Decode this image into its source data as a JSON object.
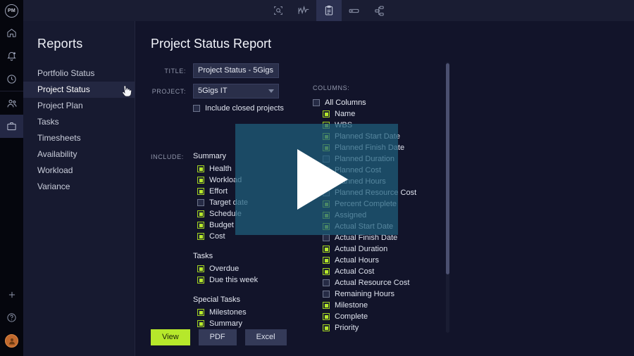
{
  "rail": {
    "logo": "PM",
    "items": [
      {
        "name": "home-icon",
        "label": "Home"
      },
      {
        "name": "notifications-icon",
        "label": "Notifications"
      },
      {
        "name": "time-icon",
        "label": "Time"
      },
      {
        "name": "people-icon",
        "label": "People"
      },
      {
        "name": "briefcase-icon",
        "label": "Projects",
        "active": true
      }
    ],
    "bottom": [
      {
        "name": "add-icon",
        "label": "Add"
      },
      {
        "name": "help-icon",
        "label": "Help"
      },
      {
        "name": "avatar",
        "label": "User"
      }
    ]
  },
  "toolbar": {
    "items": [
      {
        "name": "search-document-icon",
        "label": "Search",
        "active": false
      },
      {
        "name": "analytics-icon",
        "label": "Analytics",
        "active": false
      },
      {
        "name": "clipboard-icon",
        "label": "Reports",
        "active": true
      },
      {
        "name": "card-icon",
        "label": "Board",
        "active": false
      },
      {
        "name": "hierarchy-icon",
        "label": "Structure",
        "active": false
      }
    ]
  },
  "sidebar": {
    "title": "Reports",
    "items": [
      {
        "label": "Portfolio Status",
        "active": false
      },
      {
        "label": "Project Status",
        "active": true
      },
      {
        "label": "Project Plan",
        "active": false
      },
      {
        "label": "Tasks",
        "active": false
      },
      {
        "label": "Timesheets",
        "active": false
      },
      {
        "label": "Availability",
        "active": false
      },
      {
        "label": "Workload",
        "active": false
      },
      {
        "label": "Variance",
        "active": false
      }
    ]
  },
  "main": {
    "page_title": "Project Status Report",
    "fields": {
      "title_label": "TITLE:",
      "title_value": "Project Status - 5Gigs",
      "project_label": "PROJECT:",
      "project_value": "5Gigs IT",
      "include_closed_label": "Include closed projects",
      "include_closed_checked": false
    },
    "include": {
      "label": "INCLUDE:",
      "groups": [
        {
          "heading": "Summary",
          "options": [
            {
              "label": "Health",
              "checked": true
            },
            {
              "label": "Workload",
              "checked": true
            },
            {
              "label": "Effort",
              "checked": true
            },
            {
              "label": "Target date",
              "checked": false
            },
            {
              "label": "Schedule",
              "checked": true
            },
            {
              "label": "Budget",
              "checked": true
            },
            {
              "label": "Cost",
              "checked": true
            }
          ]
        },
        {
          "heading": "Tasks",
          "options": [
            {
              "label": "Overdue",
              "checked": true
            },
            {
              "label": "Due this week",
              "checked": true
            }
          ]
        },
        {
          "heading": "Special Tasks",
          "options": [
            {
              "label": "Milestones",
              "checked": true
            },
            {
              "label": "Summary",
              "checked": true
            }
          ]
        }
      ]
    },
    "columns": {
      "label": "COLUMNS:",
      "all_label": "All Columns",
      "all_checked": false,
      "items": [
        {
          "label": "Name",
          "checked": true
        },
        {
          "label": "WBS",
          "checked": true
        },
        {
          "label": "Planned Start Date",
          "checked": true
        },
        {
          "label": "Planned Finish Date",
          "checked": true
        },
        {
          "label": "Planned Duration",
          "checked": false
        },
        {
          "label": "Planned Cost",
          "checked": false
        },
        {
          "label": "Planned Hours",
          "checked": true
        },
        {
          "label": "Planned Resource Cost",
          "checked": false
        },
        {
          "label": "Percent Complete",
          "checked": true
        },
        {
          "label": "Assigned",
          "checked": true
        },
        {
          "label": "Actual Start Date",
          "checked": true
        },
        {
          "label": "Actual Finish Date",
          "checked": false
        },
        {
          "label": "Actual Duration",
          "checked": true
        },
        {
          "label": "Actual Hours",
          "checked": true
        },
        {
          "label": "Actual Cost",
          "checked": true
        },
        {
          "label": "Actual Resource Cost",
          "checked": false
        },
        {
          "label": "Remaining Hours",
          "checked": false
        },
        {
          "label": "Milestone",
          "checked": true
        },
        {
          "label": "Complete",
          "checked": true
        },
        {
          "label": "Priority",
          "checked": true
        }
      ]
    },
    "buttons": [
      {
        "label": "View",
        "style": "primary"
      },
      {
        "label": "PDF",
        "style": "ghost"
      },
      {
        "label": "Excel",
        "style": "ghost"
      }
    ]
  },
  "overlay": {
    "name": "video-play-overlay",
    "color": "#1e5f7d"
  }
}
